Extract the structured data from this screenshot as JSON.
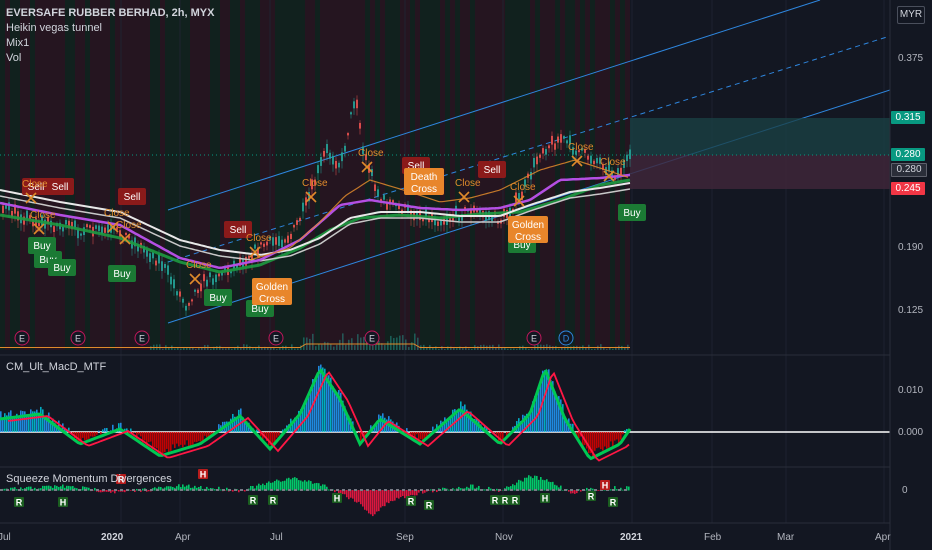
{
  "header": {
    "symbol": "EVERSAFE RUBBER BERHAD, 2h, MYX",
    "indicators": [
      "Heikin vegas tunnel",
      "Mix1",
      "Vol"
    ],
    "currency": "MYR"
  },
  "panes": {
    "macd_title": "CM_Ult_MacD_MTF",
    "squeeze_title": "Squeeze Momentum Divergences"
  },
  "price_axis": {
    "labels": [
      "0.375",
      "0.190",
      "0.125"
    ],
    "tag_target": "0.315",
    "tag_current_1": "0.280",
    "tag_current_2": "0.280",
    "tag_stop": "0.245"
  },
  "macd_axis": {
    "labels": [
      "0.010",
      "0.000"
    ]
  },
  "squeeze_axis": {
    "labels": [
      "0"
    ]
  },
  "time_axis": {
    "labels": [
      "Jul",
      "2020",
      "Apr",
      "Jul",
      "Sep",
      "Nov",
      "2021",
      "Feb",
      "Mar",
      "Apr"
    ]
  },
  "signals": [
    {
      "text": "Sell",
      "kind": "sell"
    },
    {
      "text": "Sell",
      "kind": "sell"
    },
    {
      "text": "Sell",
      "kind": "sell"
    },
    {
      "text": "Sell",
      "kind": "sell"
    },
    {
      "text": "Sell",
      "kind": "sell"
    },
    {
      "text": "Sell",
      "kind": "sell"
    },
    {
      "text": "Buy",
      "kind": "buy"
    },
    {
      "text": "Buy",
      "kind": "buy"
    },
    {
      "text": "Buy",
      "kind": "buy"
    },
    {
      "text": "Buy",
      "kind": "buy"
    },
    {
      "text": "Buy",
      "kind": "buy"
    },
    {
      "text": "Buy",
      "kind": "buy"
    },
    {
      "text": "Buy",
      "kind": "buy"
    },
    {
      "text": "Buy",
      "kind": "buy"
    },
    {
      "text": "Buy",
      "kind": "buy"
    },
    {
      "text": "Golden Cross",
      "kind": "cross"
    },
    {
      "text": "Death Cross",
      "kind": "cross"
    },
    {
      "text": "Golden Cross",
      "kind": "cross"
    }
  ],
  "close_labels": [
    "Close",
    "Close",
    "Close",
    "Close",
    "Close",
    "Close",
    "Close",
    "Close",
    "Close",
    "Close",
    "Close",
    "Close"
  ],
  "event_markers": [
    "E",
    "E",
    "E",
    "E",
    "E",
    "E",
    "D"
  ],
  "divergence_markers": [
    "R",
    "H",
    "R",
    "H",
    "R",
    "R",
    "H",
    "R",
    "R",
    "R",
    "R",
    "R",
    "H",
    "R",
    "H",
    "R"
  ],
  "colors": {
    "background": "#131722",
    "buy": "#1b7a34",
    "sell": "#8b1a1a",
    "cross": "#e8862b",
    "channel": "#2e86de",
    "target_tag": "#089981",
    "stop_tag": "#f23645",
    "current_tag": "#5d606b"
  }
}
